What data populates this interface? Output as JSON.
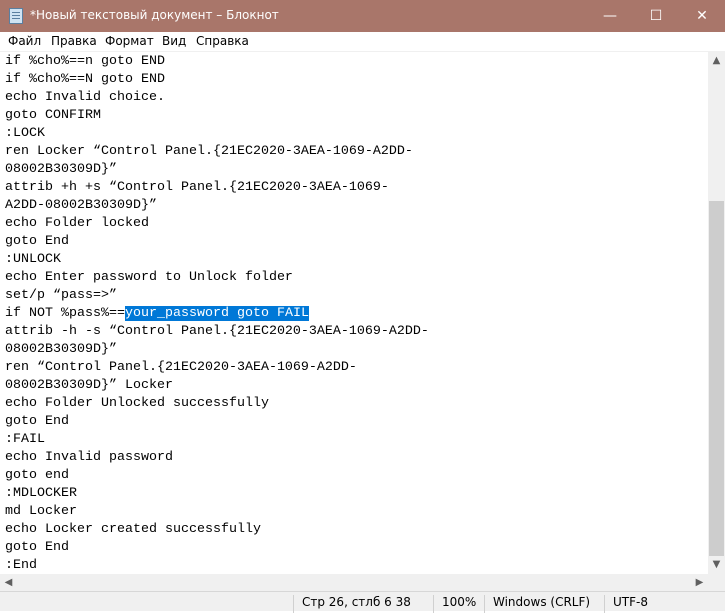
{
  "window": {
    "title": "*Новый текстовый документ – Блокнот",
    "title_color": "#a9766a",
    "minimize": "—",
    "maximize": "☐",
    "close": "✕"
  },
  "menu": [
    "Файл",
    "Правка",
    "Формат",
    "Вид",
    "Справка"
  ],
  "editor": {
    "lines": [
      "if %cho%==n goto END",
      "if %cho%==N goto END",
      "echo Invalid choice.",
      "goto CONFIRM",
      ":LOCK",
      "ren Locker “Control Panel.{21EC2020-3AEA-1069-A2DD-",
      "08002B30309D}”",
      "attrib +h +s “Control Panel.{21EC2020-3AEA-1069-",
      "A2DD-08002B30309D}”",
      "echo Folder locked",
      "goto End",
      ":UNLOCK",
      "echo Enter password to Unlock folder",
      "set/p “pass=>”",
      "if NOT %pass%==",
      "attrib -h -s “Control Panel.{21EC2020-3AEA-1069-A2DD-",
      "08002B30309D}”",
      "ren “Control Panel.{21EC2020-3AEA-1069-A2DD-",
      "08002B30309D}” Locker",
      "echo Folder Unlocked successfully",
      "goto End",
      ":FAIL",
      "echo Invalid password",
      "goto end",
      ":MDLOCKER",
      "md Locker",
      "echo Locker created successfully",
      "goto End",
      ":End"
    ],
    "selected_text": "your_password goto FAIL",
    "selection_color": "#0078d7"
  },
  "status": {
    "position": "Стр 26, стлб 6 38",
    "zoom": "100%",
    "line_endings": "Windows (CRLF)",
    "encoding": "UTF-8"
  }
}
